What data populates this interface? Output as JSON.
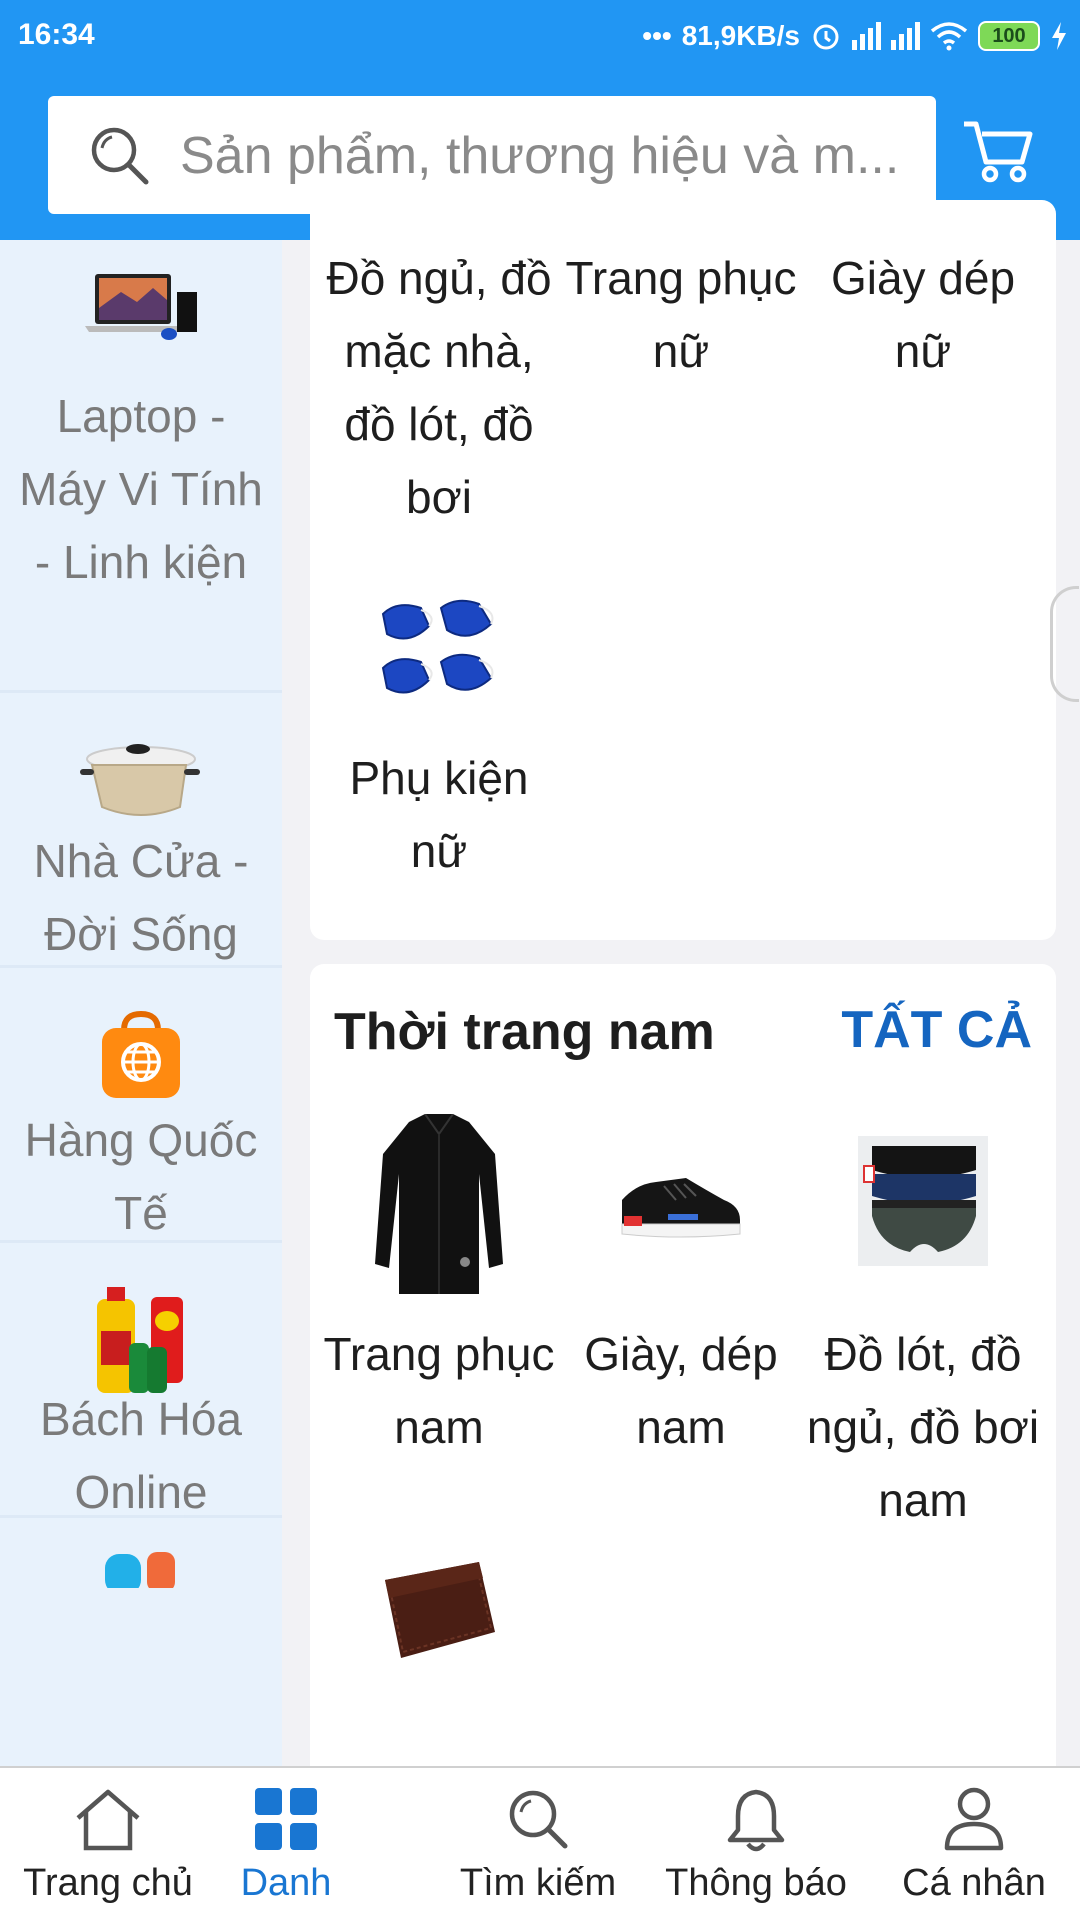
{
  "status_bar": {
    "time": "16:34",
    "network_speed": "81,9KB/s",
    "battery": "100",
    "icons": [
      "more-dots-icon",
      "alarm-icon",
      "signal-icon",
      "signal-icon",
      "wifi-icon",
      "battery-icon",
      "charging-icon"
    ]
  },
  "search": {
    "placeholder": "Sản phẩm, thương hiệu và m..."
  },
  "colors": {
    "header": "#2196f3",
    "sidebar": "#e8f2fc",
    "accent": "#1565c0",
    "active_nav": "#1976d2"
  },
  "sidebar": {
    "items": [
      {
        "label": "Laptop - Máy Vi Tính - Linh kiện",
        "icon": "laptop-icon"
      },
      {
        "label": "Nhà Cửa - Đời Sống",
        "icon": "cooking-pot-icon"
      },
      {
        "label": "Hàng Quốc Tế",
        "icon": "international-bag-icon"
      },
      {
        "label": "Bách Hóa Online",
        "icon": "grocery-icon"
      }
    ]
  },
  "women_section": {
    "tiles": [
      {
        "label": "Đồ ngủ, đồ mặc nhà, đồ lót, đồ bơi"
      },
      {
        "label": "Trang phục nữ"
      },
      {
        "label": "Giày dép nữ"
      },
      {
        "label": "Phụ kiện nữ",
        "icon": "face-mask-icon"
      }
    ]
  },
  "men_section": {
    "title": "Thời trang nam",
    "see_all": "TẤT CẢ",
    "tiles": [
      {
        "label": "Trang phục nam",
        "icon": "shirt-icon"
      },
      {
        "label": "Giày, dép nam",
        "icon": "sneaker-icon"
      },
      {
        "label": "Đồ lót, đồ ngủ, đồ bơi nam",
        "icon": "underwear-icon"
      },
      {
        "label": "",
        "icon": "wallet-icon"
      }
    ]
  },
  "bottom_nav": {
    "items": [
      {
        "label": "Trang chủ",
        "icon": "home-icon"
      },
      {
        "label": "Danh",
        "icon": "grid-icon",
        "active": true
      },
      {
        "label": "Tìm kiếm",
        "icon": "search-icon"
      },
      {
        "label": "Thông báo",
        "icon": "bell-icon"
      },
      {
        "label": "Cá nhân",
        "icon": "user-icon"
      }
    ]
  }
}
